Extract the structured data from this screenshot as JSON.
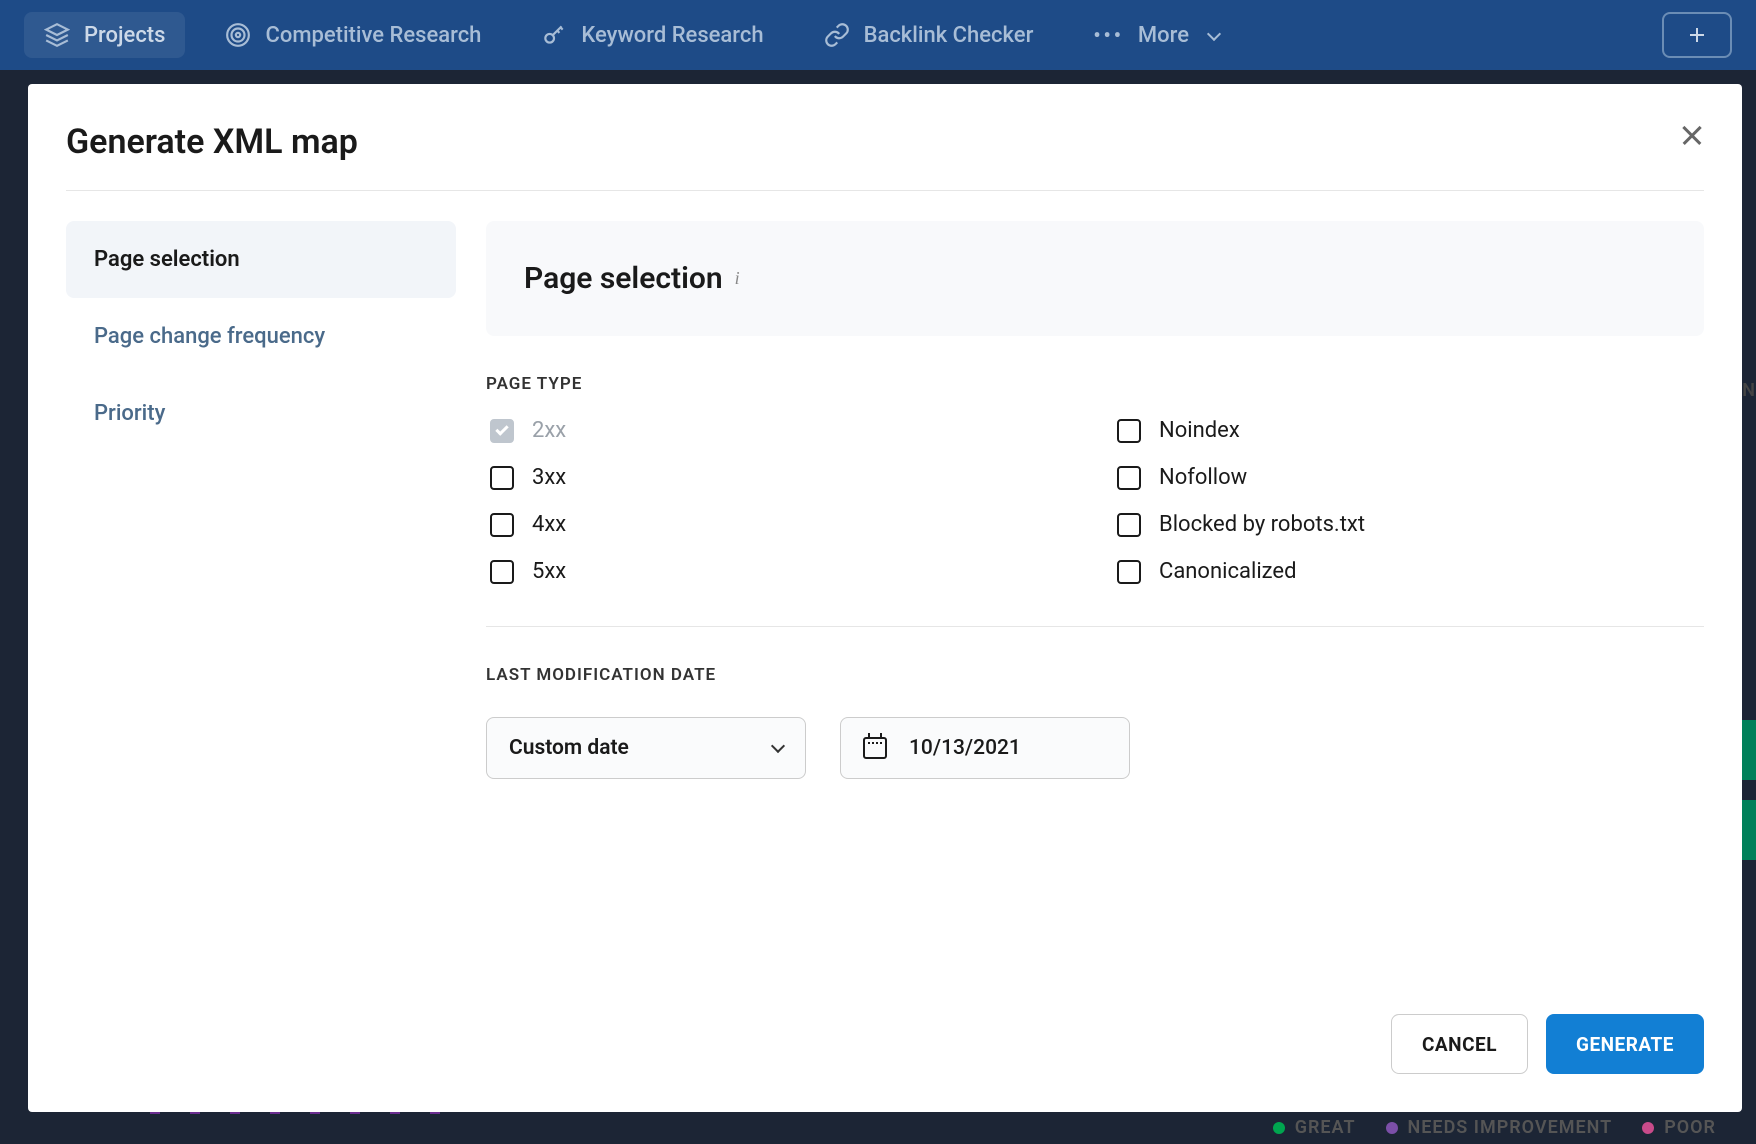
{
  "nav": {
    "items": [
      {
        "label": "Projects"
      },
      {
        "label": "Competitive Research"
      },
      {
        "label": "Keyword Research"
      },
      {
        "label": "Backlink Checker"
      }
    ],
    "more": "More"
  },
  "modal": {
    "title": "Generate XML map",
    "tabs": [
      {
        "label": "Page selection"
      },
      {
        "label": "Page change frequency"
      },
      {
        "label": "Priority"
      }
    ],
    "section_title": "Page selection",
    "page_type_label": "PAGE TYPE",
    "checkboxes_left": [
      {
        "label": "2xx",
        "disabled": true,
        "checked": true
      },
      {
        "label": "3xx",
        "disabled": false,
        "checked": false
      },
      {
        "label": "4xx",
        "disabled": false,
        "checked": false
      },
      {
        "label": "5xx",
        "disabled": false,
        "checked": false
      }
    ],
    "checkboxes_right": [
      {
        "label": "Noindex",
        "disabled": false,
        "checked": false
      },
      {
        "label": "Nofollow",
        "disabled": false,
        "checked": false
      },
      {
        "label": "Blocked by robots.txt",
        "disabled": false,
        "checked": false
      },
      {
        "label": "Canonicalized",
        "disabled": false,
        "checked": false
      }
    ],
    "last_mod_label": "LAST MODIFICATION DATE",
    "date_select": "Custom date",
    "date_value": "10/13/2021",
    "cancel": "CANCEL",
    "generate": "GENERATE"
  },
  "legend": {
    "great": "GREAT",
    "needs": "NEEDS IMPROVEMENT",
    "poor": "POOR"
  },
  "bg": {
    "sen": "SEN"
  }
}
